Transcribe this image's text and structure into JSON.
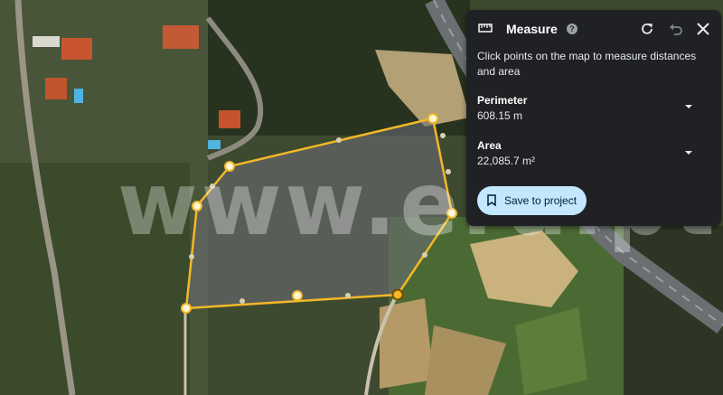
{
  "watermark": "www.era.pt",
  "colors": {
    "polygon_stroke": "#f2b829",
    "polygon_fill": "rgba(110,110,120,0.55)",
    "panel_bg": "#202124",
    "button_bg": "#c2e7ff"
  },
  "measure_panel": {
    "title": "Measure",
    "help_icon": "help-circle-icon",
    "description": "Click points on the map to measure distances and area",
    "perimeter": {
      "label": "Perimeter",
      "value": "608.15 m"
    },
    "area": {
      "label": "Area",
      "value": "22,085.7 m²"
    },
    "save_label": "Save to project",
    "header_icons": [
      "ruler-icon",
      "refresh-icon",
      "undo-icon",
      "close-icon"
    ]
  }
}
